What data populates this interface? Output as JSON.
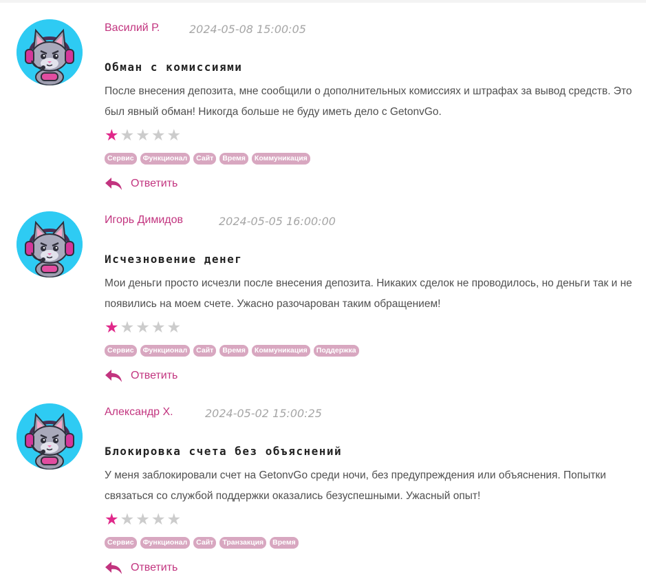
{
  "colors": {
    "accent": "#c2347f",
    "star_on": "#e0288a",
    "star_off": "#cccccc",
    "tag_bg": "#d8a7c0",
    "avatar_bg": "#2ecbf3"
  },
  "icons": {
    "avatar": "cat-gamer-avatar-icon",
    "star": "star-icon",
    "reply": "reply-arrow-icon"
  },
  "reviews": [
    {
      "author": "Василий Р.",
      "date": "2024-05-08 15:00:05",
      "title": "Обман с комиссиями",
      "text": "После внесения депозита, мне сообщили о дополнительных комиссиях и штрафах за вывод средств. Это был явный обман! Никогда больше не буду иметь дело с GetonvGo.",
      "rating": 1,
      "max_rating": 5,
      "tags": [
        "Сервис",
        "Функционал",
        "Сайт",
        "Время",
        "Коммуникация"
      ],
      "reply_label": "Ответить"
    },
    {
      "author": "Игорь Димидов",
      "date": "2024-05-05 16:00:00",
      "title": "Исчезновение денег",
      "text": "Мои деньги просто исчезли после внесения депозита. Никаких сделок не проводилось, но деньги так и не появились на моем счете. Ужасно разочарован таким обращением!",
      "rating": 1,
      "max_rating": 5,
      "tags": [
        "Сервис",
        "Функционал",
        "Сайт",
        "Время",
        "Коммуникация",
        "Поддержка"
      ],
      "reply_label": "Ответить"
    },
    {
      "author": "Александр Х.",
      "date": "2024-05-02 15:00:25",
      "title": "Блокировка счета без объяснений",
      "text": "У меня заблокировали счет на GetonvGo среди ночи, без предупреждения или объяснения. Попытки связаться со службой поддержки оказались безуспешными. Ужасный опыт!",
      "rating": 1,
      "max_rating": 5,
      "tags": [
        "Сервис",
        "Функционал",
        "Сайт",
        "Транзакция",
        "Время"
      ],
      "reply_label": "Ответить"
    }
  ]
}
